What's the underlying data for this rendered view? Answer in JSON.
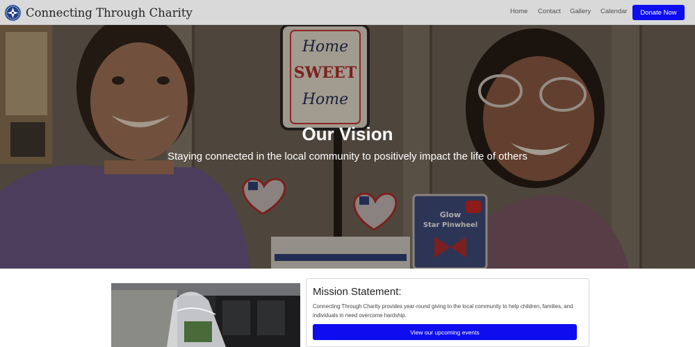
{
  "brand": {
    "name": "Connecting Through Charity",
    "logo_icon": "cross-logo-icon"
  },
  "nav": {
    "items": [
      {
        "label": "Home"
      },
      {
        "label": "Contact"
      },
      {
        "label": "Gallery"
      },
      {
        "label": "Calendar"
      }
    ],
    "donate_label": "Donate Now"
  },
  "hero": {
    "title": "Our Vision",
    "subtitle": "Staying connected in the local community to positively impact the life of others",
    "sign_text": [
      "Home",
      "SWEET",
      "Home"
    ],
    "package_text": [
      "Glow",
      "Star Pinwheel"
    ]
  },
  "mission": {
    "title": "Mission Statement:",
    "text": "Connecting Through Charity provides year-round giving to the local community to help children, families, and individuals in need overcome hardship.",
    "button_label": "View our upcoming events"
  },
  "colors": {
    "primary": "#0d0df0",
    "navbar_bg": "#d9d9d9"
  }
}
